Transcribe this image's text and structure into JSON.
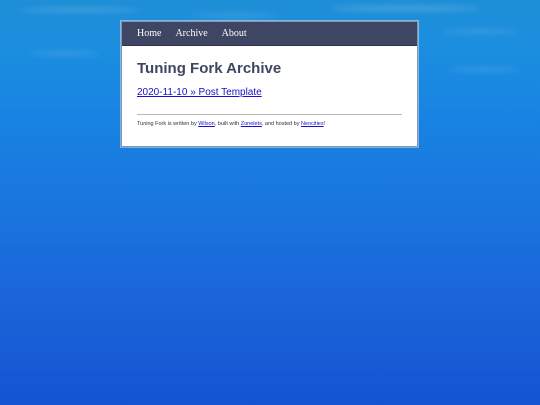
{
  "nav": {
    "items": [
      "Home",
      "Archive",
      "About"
    ]
  },
  "page": {
    "title": "Tuning Fork Archive"
  },
  "posts": [
    {
      "label": "2020-11-10 » Post Template"
    }
  ],
  "footer": {
    "text_1": "Tuning Fork is written by ",
    "author_link": "Wilson",
    "text_2": ", built with ",
    "builder_link": "Zonelets",
    "text_3": ", and hosted by ",
    "host_link": "Neocities",
    "text_4": "!"
  },
  "colors": {
    "nav_background": "#3e4663",
    "title": "#3e4663",
    "link": "#1a0dcc",
    "page_background": "#1883e2"
  }
}
